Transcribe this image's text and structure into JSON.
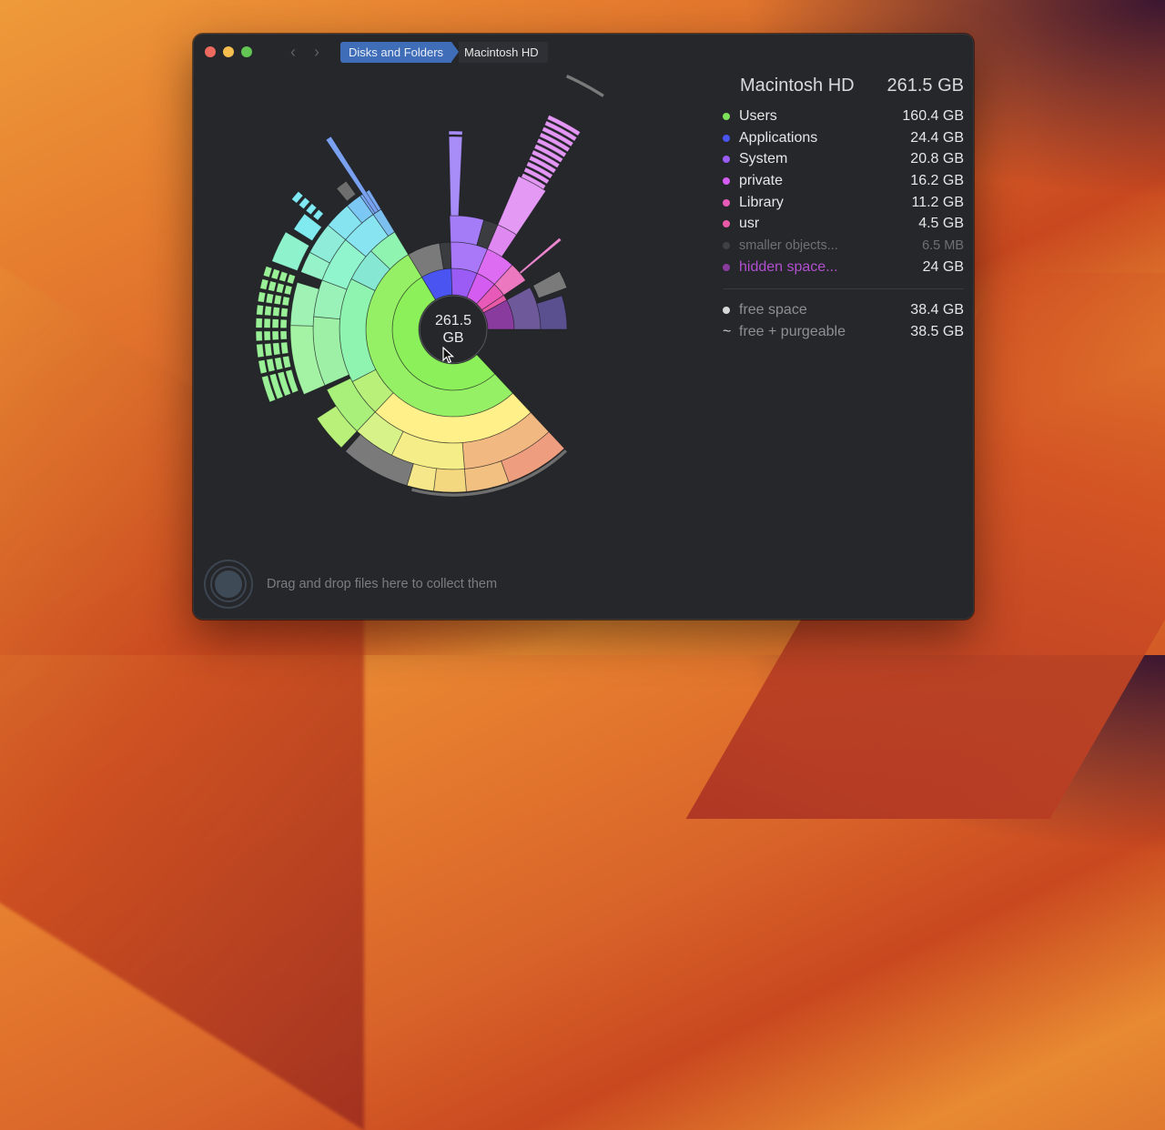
{
  "window": {
    "nav": {
      "back_icon": "‹",
      "forward_icon": "›"
    },
    "breadcrumb": [
      {
        "label": "Disks and Folders",
        "active": true
      },
      {
        "label": "Macintosh HD",
        "active": false
      }
    ]
  },
  "chart_data": {
    "type": "sunburst",
    "title": "Macintosh HD",
    "center_label": "261.5\nGB",
    "center_value": "261.5",
    "center_unit": "GB",
    "total_gb": 261.5,
    "free_gb": 38.4,
    "segments": [
      {
        "name": "Users",
        "value_gb": 160.4,
        "color": "#8cf05a"
      },
      {
        "name": "Applications",
        "value_gb": 24.4,
        "color": "#4a54f0"
      },
      {
        "name": "System",
        "value_gb": 20.8,
        "color": "#9a5cf4"
      },
      {
        "name": "private",
        "value_gb": 16.2,
        "color": "#d45cf0"
      },
      {
        "name": "Library",
        "value_gb": 11.2,
        "color": "#e85ab8"
      },
      {
        "name": "usr",
        "value_gb": 4.5,
        "color": "#e85aa8"
      },
      {
        "name": "smaller objects...",
        "value_gb": 0.0065,
        "color": "#3e4046"
      },
      {
        "name": "hidden space...",
        "value_gb": 24,
        "color": "#8a3c9e"
      }
    ]
  },
  "panel": {
    "title": "Macintosh HD",
    "total": "261.5 GB",
    "items": [
      {
        "name": "Users",
        "size": "160.4 GB",
        "color": "#7ee05a",
        "style": "normal"
      },
      {
        "name": "Applications",
        "size": "24.4 GB",
        "color": "#4a54f0",
        "style": "normal"
      },
      {
        "name": "System",
        "size": "20.8 GB",
        "color": "#9a5cf4",
        "style": "normal"
      },
      {
        "name": "private",
        "size": "16.2 GB",
        "color": "#d45cf0",
        "style": "normal"
      },
      {
        "name": "Library",
        "size": "11.2 GB",
        "color": "#e85ab8",
        "style": "normal"
      },
      {
        "name": "usr",
        "size": "4.5 GB",
        "color": "#e85aa8",
        "style": "normal"
      },
      {
        "name": "smaller objects...",
        "size": "6.5  MB",
        "color": "#3e4046",
        "style": "dim"
      },
      {
        "name": "hidden space...",
        "size": "24    GB",
        "color": "#8a3c9e",
        "style": "hidden"
      }
    ],
    "free": [
      {
        "name": "free space",
        "size": "38.4 GB",
        "marker": "dot"
      },
      {
        "name": "free + purgeable",
        "size": "38.5 GB",
        "marker": "~"
      }
    ]
  },
  "footer": {
    "drop_text": "Drag and drop files here to collect them"
  }
}
